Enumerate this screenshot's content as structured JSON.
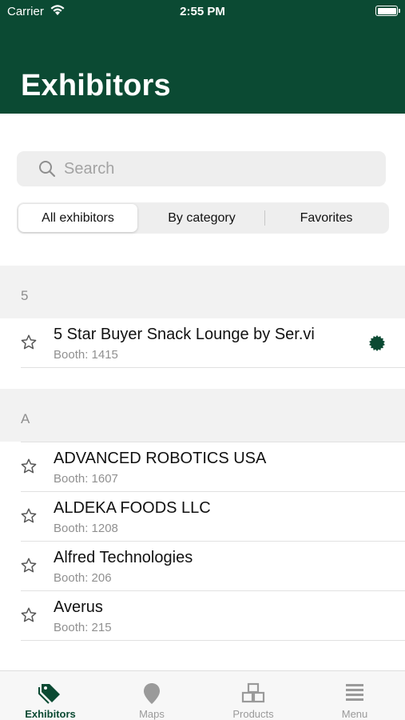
{
  "status_bar": {
    "carrier": "Carrier",
    "time": "2:55 PM"
  },
  "header": {
    "title": "Exhibitors"
  },
  "search": {
    "placeholder": "Search"
  },
  "segments": [
    "All exhibitors",
    "By category",
    "Favorites"
  ],
  "selected_segment": "All exhibitors",
  "sections": [
    {
      "letter": "5",
      "rows": [
        {
          "name": "5 Star Buyer Snack Lounge by Ser.vi",
          "booth": "Booth: 1415",
          "has_badge": true
        }
      ]
    },
    {
      "letter": "A",
      "rows": [
        {
          "name": "ADVANCED ROBOTICS USA",
          "booth": "Booth: 1607"
        },
        {
          "name": "ALDEKA FOODS LLC",
          "booth": "Booth: 1208"
        },
        {
          "name": "Alfred Technologies",
          "booth": "Booth: 206"
        },
        {
          "name": "Averus",
          "booth": "Booth: 215"
        }
      ]
    }
  ],
  "tabs": [
    "Exhibitors",
    "Maps",
    "Products",
    "Menu"
  ],
  "active_tab": "Exhibitors",
  "icons": {
    "star": "star-outline-icon",
    "badge": "featured-seal-icon",
    "tabs": [
      "tag-icon",
      "map-pin-icon",
      "boxes-icon",
      "hamburger-menu-icon"
    ]
  },
  "colors": {
    "brand_green": "#0b4a33",
    "inactive_tab": "#9a9a9a",
    "section_bg": "#f2f2f2"
  }
}
